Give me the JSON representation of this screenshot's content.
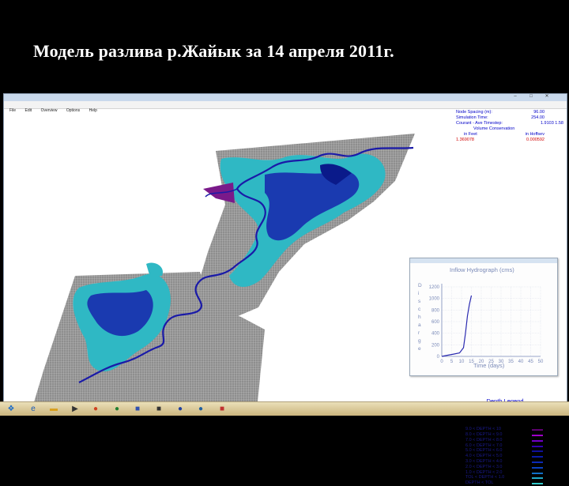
{
  "slide": {
    "title": "Модель разлива р.Жайык за 14 апреля 2011г."
  },
  "window": {
    "title": "",
    "menu": [
      "File",
      "Edit",
      "Overview",
      "Options",
      "Help"
    ]
  },
  "status_panel": {
    "rows": [
      {
        "label": "Node Spacing (m):",
        "value": "96.00"
      },
      {
        "label": "Simulation Time:",
        "value": "254.00"
      },
      {
        "label": "Courant - Ave Timestep:",
        "value": "1.9103   1.58"
      },
      {
        "label": "Volume Conservation",
        "value": ""
      },
      {
        "label": "in Feet",
        "value": "in Hoffsev"
      },
      {
        "label": "1.369078",
        "value": "0.000592",
        "red": true
      }
    ]
  },
  "hydrograph": {
    "title": "Inflow Hydrograph (cms)",
    "ylabel": "D i s c h a r g e",
    "xlabel": "Time (days)",
    "yticks": [
      "1200",
      "1000",
      "800",
      "600",
      "400",
      "200",
      "0"
    ],
    "xticks": [
      "0",
      "5",
      "10",
      "15",
      "20",
      "25",
      "30",
      "35",
      "40",
      "45",
      "50"
    ]
  },
  "chart_data": {
    "type": "line",
    "title": "Inflow Hydrograph (cms)",
    "xlabel": "Time (days)",
    "ylabel": "Discharge",
    "xlim": [
      0,
      50
    ],
    "ylim": [
      0,
      1200
    ],
    "series": [
      {
        "x": [
          0,
          3,
          6,
          9,
          11,
          12,
          13,
          14,
          15
        ],
        "y": [
          0,
          20,
          40,
          60,
          150,
          400,
          700,
          900,
          1050
        ]
      }
    ]
  },
  "legend": {
    "title": "Depth Legend",
    "items": [
      {
        "label": "13. < DEPTH < 14",
        "color": "#e8003c"
      },
      {
        "label": "12. < DEPTH < 13",
        "color": "#d4003a"
      },
      {
        "label": "11. < DEPTH < 12",
        "color": "#b00045"
      },
      {
        "label": "10. < DEPTH < 11",
        "color": "#8a0058"
      },
      {
        "label": "9.0 < DEPTH < 10",
        "color": "#5e0070"
      },
      {
        "label": "8.0 < DEPTH < 9.0",
        "color": "#a000c8"
      },
      {
        "label": "7.0 < DEPTH < 8.0",
        "color": "#7000c8"
      },
      {
        "label": "6.0 < DEPTH < 7.0",
        "color": "#3000b0"
      },
      {
        "label": "5.0 < DEPTH < 6.0",
        "color": "#10109a"
      },
      {
        "label": "4.0 < DEPTH < 5.0",
        "color": "#0a1aa8"
      },
      {
        "label": "3.0 < DEPTH < 4.0",
        "color": "#0a2ab8"
      },
      {
        "label": "2.0 < DEPTH < 3.0",
        "color": "#0a40c0"
      },
      {
        "label": "1.0 < DEPTH < 2.0",
        "color": "#1070c8"
      },
      {
        "label": "TOL < DEPTH < 1.0",
        "color": "#20a8c8"
      },
      {
        "label": "DEPTH < TOL",
        "color": "#30c8c8"
      }
    ]
  },
  "taskbar": {
    "clock_time": "",
    "clock_date": ""
  },
  "colors": {
    "grid": "#9a9a9a",
    "shallow": "#2fb8c4",
    "deep": "#1424a8",
    "channel": "#1a1aa8",
    "zone": "#7a1a8a"
  }
}
